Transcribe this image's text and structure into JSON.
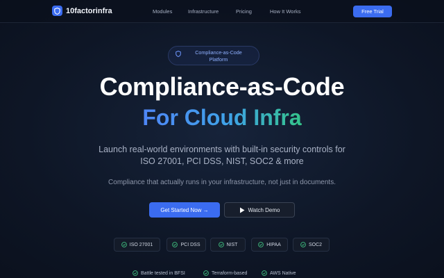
{
  "brand": {
    "name": "10factorinfra"
  },
  "nav": {
    "links": [
      "Modules",
      "Infrastructure",
      "Pricing",
      "How It Works"
    ],
    "cta": "Free Trial"
  },
  "hero": {
    "badge_line1": "Compliance-as-Code",
    "badge_line2": "Platform",
    "title": "Compliance-as-Code",
    "title_gradient": "For Cloud Infra",
    "subtitle": "Launch real-world environments with built-in security controls for ISO 27001, PCI DSS, NIST, SOC2 & more",
    "tagline": "Compliance that actually runs in your infrastructure, not just in documents.",
    "primary_cta": "Get Started Now →",
    "secondary_cta": "Watch Demo"
  },
  "standards": [
    "ISO 27001",
    "PCI DSS",
    "NIST",
    "HIPAA",
    "SOC2"
  ],
  "features": [
    "Battle tested in BFSI",
    "Terraform-based",
    "AWS Native"
  ],
  "colors": {
    "accent": "#3b6cf0",
    "check": "#3fbf7f",
    "gradient_start": "#4f86f7",
    "gradient_end": "#34c48a"
  }
}
